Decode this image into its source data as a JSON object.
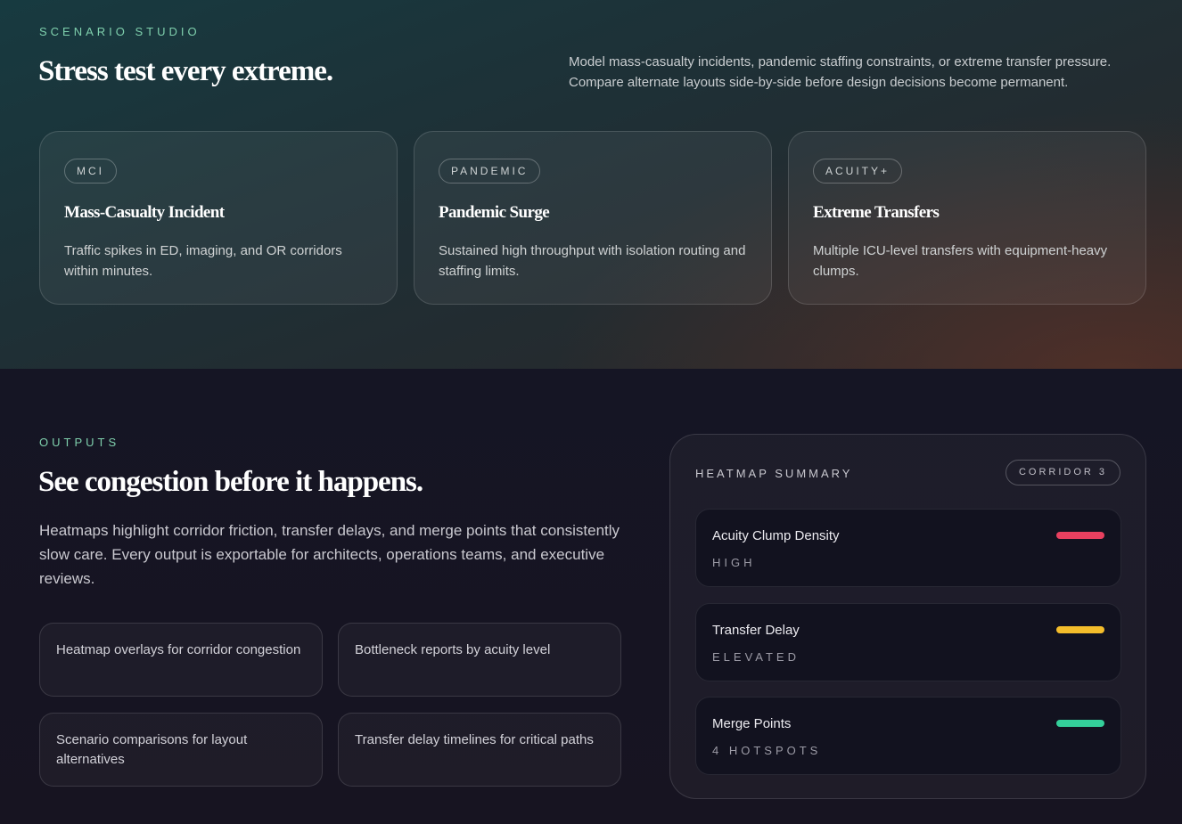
{
  "scenario": {
    "eyebrow": "SCENARIO STUDIO",
    "heading": "Stress test every extreme.",
    "description": "Model mass-casualty incidents, pandemic staffing constraints, or extreme transfer pressure. Compare alternate layouts side-by-side before design decisions become permanent.",
    "cards": [
      {
        "tag": "MCI",
        "title": "Mass-Casualty Incident",
        "description": "Traffic spikes in ED, imaging, and OR corridors within minutes."
      },
      {
        "tag": "PANDEMIC",
        "title": "Pandemic Surge",
        "description": "Sustained high throughput with isolation routing and staffing limits."
      },
      {
        "tag": "ACUITY+",
        "title": "Extreme Transfers",
        "description": "Multiple ICU-level transfers with equipment-heavy clumps."
      }
    ]
  },
  "outputs": {
    "eyebrow": "OUTPUTS",
    "heading": "See congestion before it happens.",
    "description": "Heatmaps highlight corridor friction, transfer delays, and merge points that consistently slow care. Every output is exportable for architects, operations teams, and executive reviews.",
    "features": [
      "Heatmap overlays for corridor congestion",
      "Bottleneck reports by acuity level",
      "Scenario comparisons for layout alternatives",
      "Transfer delay timelines for critical paths"
    ]
  },
  "heatmap": {
    "title": "HEATMAP SUMMARY",
    "corridor": "CORRIDOR 3",
    "metrics": [
      {
        "name": "Acuity Clump Density",
        "level": "HIGH",
        "color": "#e8405f"
      },
      {
        "name": "Transfer Delay",
        "level": "ELEVATED",
        "color": "#f4bd2b"
      },
      {
        "name": "Merge Points",
        "level": "4 HOTSPOTS",
        "color": "#34cf9a"
      }
    ]
  }
}
